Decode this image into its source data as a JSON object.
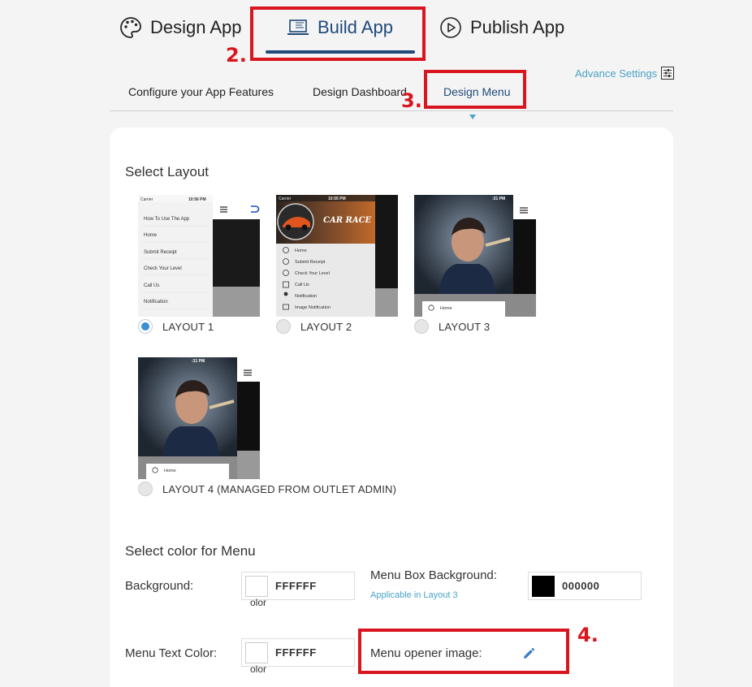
{
  "nav": {
    "design_tab": "Design App",
    "build_tab": "Build App",
    "publish_tab": "Publish App"
  },
  "advance_settings": "Advance Settings",
  "subtabs": {
    "configure": "Configure your App Features",
    "dashboard": "Design Dashboard",
    "menu": "Design Menu"
  },
  "annotations": {
    "a2": "2.",
    "a3": "3.",
    "a4": "4."
  },
  "layouts": {
    "title": "Select Layout",
    "options": [
      {
        "label": "LAYOUT 1",
        "selected": true
      },
      {
        "label": "LAYOUT 2",
        "selected": false
      },
      {
        "label": "LAYOUT 3",
        "selected": false
      },
      {
        "label": "LAYOUT 4 (MANAGED FROM OUTLET ADMIN)",
        "selected": false
      }
    ],
    "preview1": {
      "carrier": "Carrier",
      "time": "10:56 PM",
      "items": [
        "How To Use The App",
        "Home",
        "Submit Receipt",
        "Check Your Level",
        "Call Us",
        "Notification"
      ]
    },
    "preview2": {
      "carrier": "Carrier",
      "time": "10:55 PM",
      "banner": "CAR RACE",
      "items": [
        "Home",
        "Submit Receipt",
        "Check Your Level",
        "Call Us",
        "Notification",
        "Image Notification"
      ]
    },
    "preview3": {
      "time": ":31 PM",
      "item": "Home"
    },
    "preview4": {
      "time": ":31 PM",
      "item": "Home"
    }
  },
  "colors": {
    "title": "Select color for Menu",
    "background_label": "Background:",
    "background_value": "FFFFFF",
    "background_swatch": "#FFFFFF",
    "menu_box_label": "Menu Box Background:",
    "menu_box_hint": "Applicable in Layout 3",
    "menu_box_value": "000000",
    "menu_box_swatch": "#000000",
    "text_color_label": "Menu Text Color:",
    "text_color_value": "FFFFFF",
    "text_color_swatch": "#FFFFFF",
    "swatch_text": "olor",
    "opener_label": "Menu opener image:"
  },
  "theme": {
    "accent": "#1f4a7a",
    "link": "#4aa3c8",
    "annotation": "#d9161f"
  }
}
